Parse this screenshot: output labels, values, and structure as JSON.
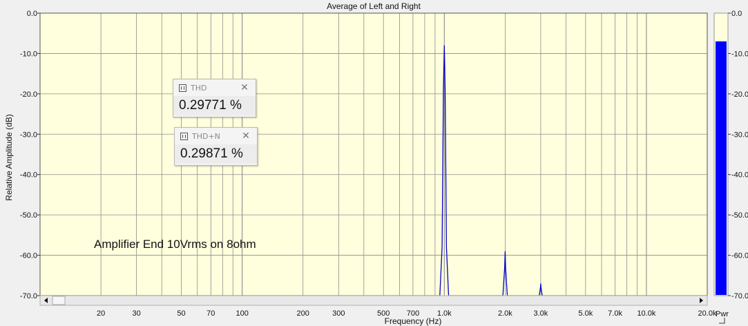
{
  "chart_data": {
    "type": "line",
    "title": "Average of Left and Right",
    "xlabel": "Frequency (Hz)",
    "ylabel": "Relative Amplitude (dB)",
    "x_scale": "log",
    "xlim": [
      10,
      20000
    ],
    "ylim": [
      -70,
      0
    ],
    "grid": true,
    "y_ticks": [
      "0.0",
      "-10.0",
      "-20.0",
      "-30.0",
      "-40.0",
      "-50.0",
      "-60.0",
      "-70.0"
    ],
    "x_ticks": [
      {
        "value": 20,
        "label": "20"
      },
      {
        "value": 30,
        "label": "30"
      },
      {
        "value": 50,
        "label": "50"
      },
      {
        "value": 70,
        "label": "70"
      },
      {
        "value": 100,
        "label": "100"
      },
      {
        "value": 200,
        "label": "200"
      },
      {
        "value": 300,
        "label": "300"
      },
      {
        "value": 500,
        "label": "500"
      },
      {
        "value": 700,
        "label": "700"
      },
      {
        "value": 1000,
        "label": "1.0k"
      },
      {
        "value": 2000,
        "label": "2.0k"
      },
      {
        "value": 3000,
        "label": "3.0k"
      },
      {
        "value": 5000,
        "label": "5.0k"
      },
      {
        "value": 7000,
        "label": "7.0k"
      },
      {
        "value": 10000,
        "label": "10.0k"
      },
      {
        "value": 20000,
        "label": "20.0k"
      }
    ],
    "series": [
      {
        "color": "#0000cc",
        "x": [
          10,
          950,
          975,
          990,
          1000,
          1010,
          1025,
          1050,
          1950,
          1990,
          2000,
          2010,
          2050,
          2950,
          2990,
          3000,
          3010,
          3050,
          20000
        ],
        "y": [
          -70,
          -70,
          -58,
          -19,
          -8,
          -19,
          -58,
          -70,
          -70,
          -63,
          -59,
          -63,
          -70,
          -70,
          -68,
          -67,
          -68,
          -70,
          -70
        ]
      }
    ],
    "annotations": [
      "Amplifier End  10Vrms on 8ohm"
    ],
    "power_meter": {
      "label": "Pwr",
      "value_db": -7,
      "ticks": [
        "0.0",
        "-10.0",
        "-20.0",
        "-30.0",
        "-40.0",
        "-50.0",
        "-60.0",
        "-70.0"
      ],
      "color": "#0000ff"
    }
  },
  "readouts": [
    {
      "title": "THD",
      "value": "0.29771 %"
    },
    {
      "title": "THD+N",
      "value": "0.29871 %"
    }
  ],
  "colors": {
    "plot_bg": "#ffffdd",
    "grid": "#8c8c8c",
    "trace": "#0000cc"
  }
}
